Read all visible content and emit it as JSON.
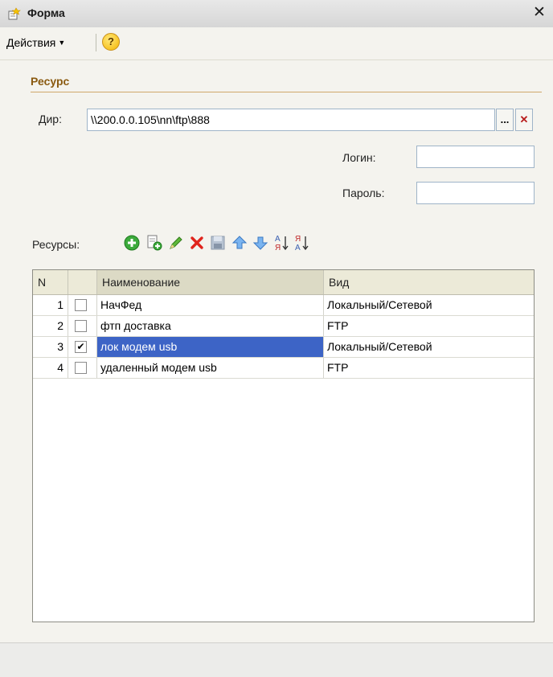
{
  "window": {
    "title": "Форма",
    "close_glyph": "✕"
  },
  "menu": {
    "actions_label": "Действия",
    "help_label": "?"
  },
  "resource_group": {
    "title": "Ресурс",
    "dir_label": "Дир:",
    "dir_value": "\\\\200.0.0.105\\nn\\ftp\\888",
    "browse_label": "...",
    "clear_label": "✕",
    "login_label": "Логин:",
    "login_value": "",
    "password_label": "Пароль:",
    "password_value": ""
  },
  "resources_label": "Ресурсы:",
  "toolbar": {
    "icons": [
      "add-icon",
      "copy-icon",
      "edit-icon",
      "delete-icon",
      "save-icon",
      "move-up-icon",
      "move-down-icon",
      "sort-asc-icon",
      "sort-desc-icon"
    ]
  },
  "table": {
    "headers": {
      "n": "N",
      "check": "",
      "name": "Наименование",
      "type": "Вид"
    },
    "rows": [
      {
        "n": "1",
        "checked": false,
        "name": "НачФед",
        "type": "Локальный/Сетевой"
      },
      {
        "n": "2",
        "checked": false,
        "name": "фтп доставка",
        "type": "FTP"
      },
      {
        "n": "3",
        "checked": true,
        "name": "лок модем usb",
        "type": "Локальный/Сетевой",
        "selected": true
      },
      {
        "n": "4",
        "checked": false,
        "name": "удаленный модем usb",
        "type": "FTP"
      }
    ],
    "check_mark": "✔"
  },
  "colors": {
    "selection": "#3d64c6",
    "group_title": "#8a5a10",
    "field_border": "#9fb4c8"
  }
}
